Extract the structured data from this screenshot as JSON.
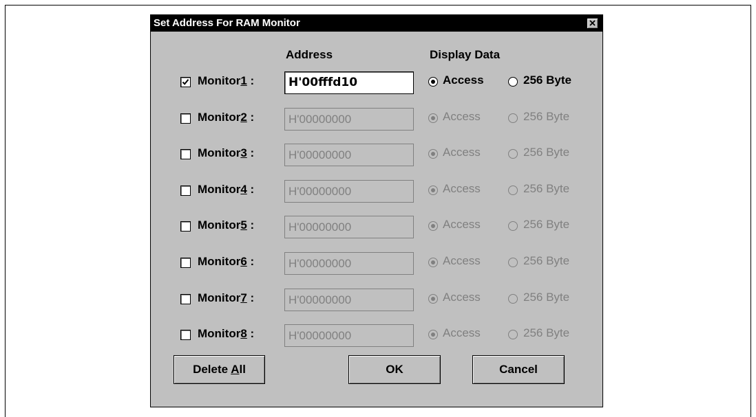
{
  "dialog": {
    "title": "Set Address For RAM Monitor",
    "headers": {
      "address": "Address",
      "display_data": "Display Data"
    },
    "monitors": [
      {
        "label_prefix": "Monitor",
        "num": "1",
        "colon": " :",
        "checked": true,
        "address": "H'00fffd10",
        "access": "Access",
        "byte256": "256 Byte",
        "selected": "access",
        "enabled": true
      },
      {
        "label_prefix": "Monitor",
        "num": "2",
        "colon": " :",
        "checked": false,
        "address": "H'00000000",
        "access": "Access",
        "byte256": "256 Byte",
        "selected": "access",
        "enabled": false
      },
      {
        "label_prefix": "Monitor",
        "num": "3",
        "colon": " :",
        "checked": false,
        "address": "H'00000000",
        "access": "Access",
        "byte256": "256 Byte",
        "selected": "access",
        "enabled": false
      },
      {
        "label_prefix": "Monitor",
        "num": "4",
        "colon": " :",
        "checked": false,
        "address": "H'00000000",
        "access": "Access",
        "byte256": "256 Byte",
        "selected": "access",
        "enabled": false
      },
      {
        "label_prefix": "Monitor",
        "num": "5",
        "colon": " :",
        "checked": false,
        "address": "H'00000000",
        "access": "Access",
        "byte256": "256 Byte",
        "selected": "access",
        "enabled": false
      },
      {
        "label_prefix": "Monitor",
        "num": "6",
        "colon": " :",
        "checked": false,
        "address": "H'00000000",
        "access": "Access",
        "byte256": "256 Byte",
        "selected": "access",
        "enabled": false
      },
      {
        "label_prefix": "Monitor",
        "num": "7",
        "colon": " :",
        "checked": false,
        "address": "H'00000000",
        "access": "Access",
        "byte256": "256 Byte",
        "selected": "access",
        "enabled": false
      },
      {
        "label_prefix": "Monitor",
        "num": "8",
        "colon": " :",
        "checked": false,
        "address": "H'00000000",
        "access": "Access",
        "byte256": "256 Byte",
        "selected": "access",
        "enabled": false
      }
    ],
    "buttons": {
      "delete_all": {
        "before": "Delete ",
        "mnemonic": "A",
        "after": "ll"
      },
      "ok": "OK",
      "cancel": "Cancel"
    }
  },
  "icons": {
    "close": "close-x-icon",
    "check": "checkmark-icon",
    "radio": "radio-dot-icon"
  },
  "colors": {
    "dialog_bg": "#c0c0c0",
    "titlebar_bg": "#000000",
    "disabled_text": "#808080"
  }
}
